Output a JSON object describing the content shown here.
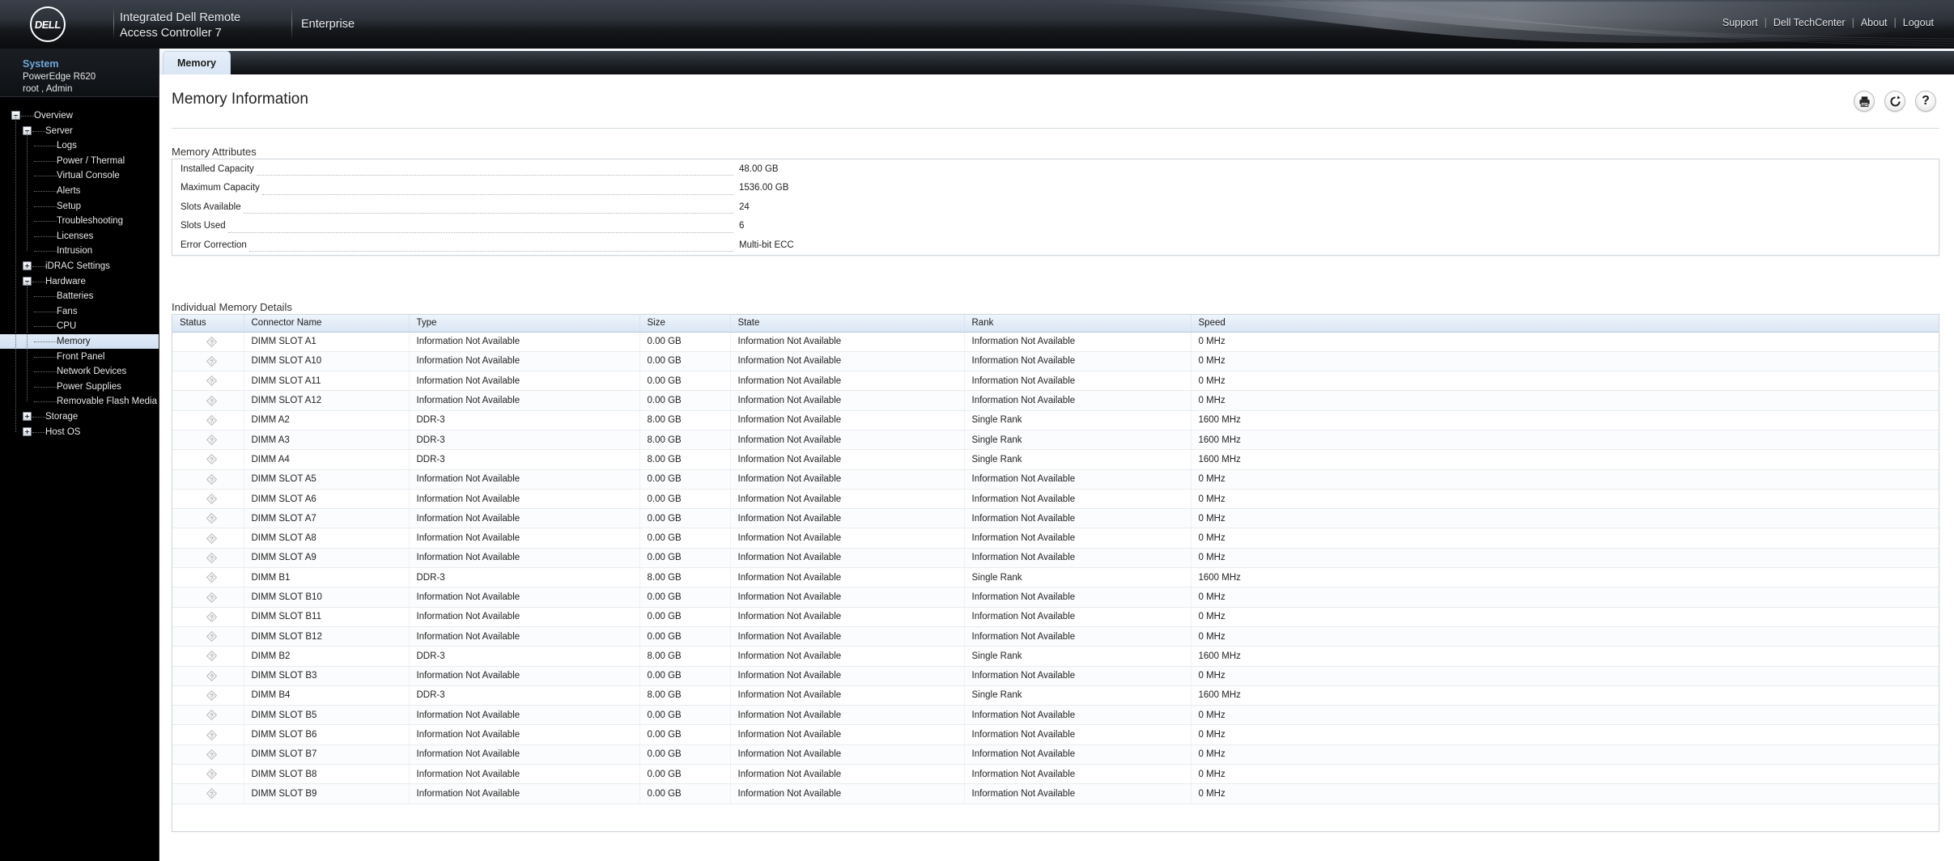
{
  "header": {
    "logo_text": "DELL",
    "product_line1": "Integrated Dell Remote",
    "product_line2": "Access Controller 7",
    "edition": "Enterprise",
    "links": [
      {
        "label": "Support"
      },
      {
        "label": "Dell TechCenter"
      },
      {
        "label": "About"
      },
      {
        "label": "Logout"
      }
    ],
    "separator": "|"
  },
  "sidebar": {
    "system_title": "System",
    "system_model": "PowerEdge R620",
    "system_user": "root , Admin",
    "tree": [
      {
        "label": "Overview",
        "level": 0,
        "toggle": "minus",
        "selected": false
      },
      {
        "label": "Server",
        "level": 1,
        "toggle": "minus",
        "selected": false
      },
      {
        "label": "Logs",
        "level": 2,
        "toggle": "none",
        "selected": false
      },
      {
        "label": "Power / Thermal",
        "level": 2,
        "toggle": "none",
        "selected": false
      },
      {
        "label": "Virtual Console",
        "level": 2,
        "toggle": "none",
        "selected": false
      },
      {
        "label": "Alerts",
        "level": 2,
        "toggle": "none",
        "selected": false
      },
      {
        "label": "Setup",
        "level": 2,
        "toggle": "none",
        "selected": false
      },
      {
        "label": "Troubleshooting",
        "level": 2,
        "toggle": "none",
        "selected": false
      },
      {
        "label": "Licenses",
        "level": 2,
        "toggle": "none",
        "selected": false
      },
      {
        "label": "Intrusion",
        "level": 2,
        "toggle": "none",
        "selected": false
      },
      {
        "label": "iDRAC Settings",
        "level": 1,
        "toggle": "plus",
        "selected": false
      },
      {
        "label": "Hardware",
        "level": 1,
        "toggle": "minus",
        "selected": false
      },
      {
        "label": "Batteries",
        "level": 2,
        "toggle": "none",
        "selected": false
      },
      {
        "label": "Fans",
        "level": 2,
        "toggle": "none",
        "selected": false
      },
      {
        "label": "CPU",
        "level": 2,
        "toggle": "none",
        "selected": false
      },
      {
        "label": "Memory",
        "level": 2,
        "toggle": "none",
        "selected": true
      },
      {
        "label": "Front Panel",
        "level": 2,
        "toggle": "none",
        "selected": false
      },
      {
        "label": "Network Devices",
        "level": 2,
        "toggle": "none",
        "selected": false
      },
      {
        "label": "Power Supplies",
        "level": 2,
        "toggle": "none",
        "selected": false
      },
      {
        "label": "Removable Flash Media",
        "level": 2,
        "toggle": "none",
        "selected": false
      },
      {
        "label": "Storage",
        "level": 1,
        "toggle": "plus",
        "selected": false
      },
      {
        "label": "Host OS",
        "level": 1,
        "toggle": "plus",
        "selected": false
      }
    ]
  },
  "main": {
    "tabs": [
      {
        "label": "Memory",
        "active": true
      }
    ],
    "page_title": "Memory Information",
    "toolbar": [
      {
        "name": "print-icon",
        "title": "Print"
      },
      {
        "name": "refresh-icon",
        "title": "Refresh"
      },
      {
        "name": "help-icon",
        "title": "Help",
        "glyph": "?"
      }
    ],
    "attributes_section": {
      "label": "Memory Attributes",
      "rows": [
        {
          "key": "Installed Capacity",
          "value": "48.00 GB"
        },
        {
          "key": "Maximum Capacity",
          "value": "1536.00 GB"
        },
        {
          "key": "Slots Available",
          "value": "24"
        },
        {
          "key": "Slots Used",
          "value": "6"
        },
        {
          "key": "Error Correction",
          "value": "Multi-bit ECC"
        }
      ]
    },
    "details_section": {
      "label": "Individual Memory Details",
      "columns": [
        "Status",
        "Connector Name",
        "Type",
        "Size",
        "State",
        "Rank",
        "Speed"
      ],
      "rows": [
        {
          "status": "unknown",
          "connector": "DIMM SLOT A1",
          "type": "Information Not Available",
          "size": "0.00 GB",
          "state": "Information Not Available",
          "rank": "Information Not Available",
          "speed": "0 MHz"
        },
        {
          "status": "unknown",
          "connector": "DIMM SLOT A10",
          "type": "Information Not Available",
          "size": "0.00 GB",
          "state": "Information Not Available",
          "rank": "Information Not Available",
          "speed": "0 MHz"
        },
        {
          "status": "unknown",
          "connector": "DIMM SLOT A11",
          "type": "Information Not Available",
          "size": "0.00 GB",
          "state": "Information Not Available",
          "rank": "Information Not Available",
          "speed": "0 MHz"
        },
        {
          "status": "unknown",
          "connector": "DIMM SLOT A12",
          "type": "Information Not Available",
          "size": "0.00 GB",
          "state": "Information Not Available",
          "rank": "Information Not Available",
          "speed": "0 MHz"
        },
        {
          "status": "unknown",
          "connector": "DIMM A2",
          "type": "DDR-3",
          "size": "8.00 GB",
          "state": "Information Not Available",
          "rank": "Single Rank",
          "speed": "1600 MHz"
        },
        {
          "status": "unknown",
          "connector": "DIMM A3",
          "type": "DDR-3",
          "size": "8.00 GB",
          "state": "Information Not Available",
          "rank": "Single Rank",
          "speed": "1600 MHz"
        },
        {
          "status": "unknown",
          "connector": "DIMM A4",
          "type": "DDR-3",
          "size": "8.00 GB",
          "state": "Information Not Available",
          "rank": "Single Rank",
          "speed": "1600 MHz"
        },
        {
          "status": "unknown",
          "connector": "DIMM SLOT A5",
          "type": "Information Not Available",
          "size": "0.00 GB",
          "state": "Information Not Available",
          "rank": "Information Not Available",
          "speed": "0 MHz"
        },
        {
          "status": "unknown",
          "connector": "DIMM SLOT A6",
          "type": "Information Not Available",
          "size": "0.00 GB",
          "state": "Information Not Available",
          "rank": "Information Not Available",
          "speed": "0 MHz"
        },
        {
          "status": "unknown",
          "connector": "DIMM SLOT A7",
          "type": "Information Not Available",
          "size": "0.00 GB",
          "state": "Information Not Available",
          "rank": "Information Not Available",
          "speed": "0 MHz"
        },
        {
          "status": "unknown",
          "connector": "DIMM SLOT A8",
          "type": "Information Not Available",
          "size": "0.00 GB",
          "state": "Information Not Available",
          "rank": "Information Not Available",
          "speed": "0 MHz"
        },
        {
          "status": "unknown",
          "connector": "DIMM SLOT A9",
          "type": "Information Not Available",
          "size": "0.00 GB",
          "state": "Information Not Available",
          "rank": "Information Not Available",
          "speed": "0 MHz"
        },
        {
          "status": "unknown",
          "connector": "DIMM B1",
          "type": "DDR-3",
          "size": "8.00 GB",
          "state": "Information Not Available",
          "rank": "Single Rank",
          "speed": "1600 MHz"
        },
        {
          "status": "unknown",
          "connector": "DIMM SLOT B10",
          "type": "Information Not Available",
          "size": "0.00 GB",
          "state": "Information Not Available",
          "rank": "Information Not Available",
          "speed": "0 MHz"
        },
        {
          "status": "unknown",
          "connector": "DIMM SLOT B11",
          "type": "Information Not Available",
          "size": "0.00 GB",
          "state": "Information Not Available",
          "rank": "Information Not Available",
          "speed": "0 MHz"
        },
        {
          "status": "unknown",
          "connector": "DIMM SLOT B12",
          "type": "Information Not Available",
          "size": "0.00 GB",
          "state": "Information Not Available",
          "rank": "Information Not Available",
          "speed": "0 MHz"
        },
        {
          "status": "unknown",
          "connector": "DIMM B2",
          "type": "DDR-3",
          "size": "8.00 GB",
          "state": "Information Not Available",
          "rank": "Single Rank",
          "speed": "1600 MHz"
        },
        {
          "status": "unknown",
          "connector": "DIMM SLOT B3",
          "type": "Information Not Available",
          "size": "0.00 GB",
          "state": "Information Not Available",
          "rank": "Information Not Available",
          "speed": "0 MHz"
        },
        {
          "status": "unknown",
          "connector": "DIMM B4",
          "type": "DDR-3",
          "size": "8.00 GB",
          "state": "Information Not Available",
          "rank": "Single Rank",
          "speed": "1600 MHz"
        },
        {
          "status": "unknown",
          "connector": "DIMM SLOT B5",
          "type": "Information Not Available",
          "size": "0.00 GB",
          "state": "Information Not Available",
          "rank": "Information Not Available",
          "speed": "0 MHz"
        },
        {
          "status": "unknown",
          "connector": "DIMM SLOT B6",
          "type": "Information Not Available",
          "size": "0.00 GB",
          "state": "Information Not Available",
          "rank": "Information Not Available",
          "speed": "0 MHz"
        },
        {
          "status": "unknown",
          "connector": "DIMM SLOT B7",
          "type": "Information Not Available",
          "size": "0.00 GB",
          "state": "Information Not Available",
          "rank": "Information Not Available",
          "speed": "0 MHz"
        },
        {
          "status": "unknown",
          "connector": "DIMM SLOT B8",
          "type": "Information Not Available",
          "size": "0.00 GB",
          "state": "Information Not Available",
          "rank": "Information Not Available",
          "speed": "0 MHz"
        },
        {
          "status": "unknown",
          "connector": "DIMM SLOT B9",
          "type": "Information Not Available",
          "size": "0.00 GB",
          "state": "Information Not Available",
          "rank": "Information Not Available",
          "speed": "0 MHz"
        }
      ]
    }
  },
  "colors": {
    "header_dark": "#16181c",
    "accent_blue": "#6fa8dc",
    "tab_active_bg": "#dde8f6",
    "table_header_bg": "#d9e6f4"
  }
}
